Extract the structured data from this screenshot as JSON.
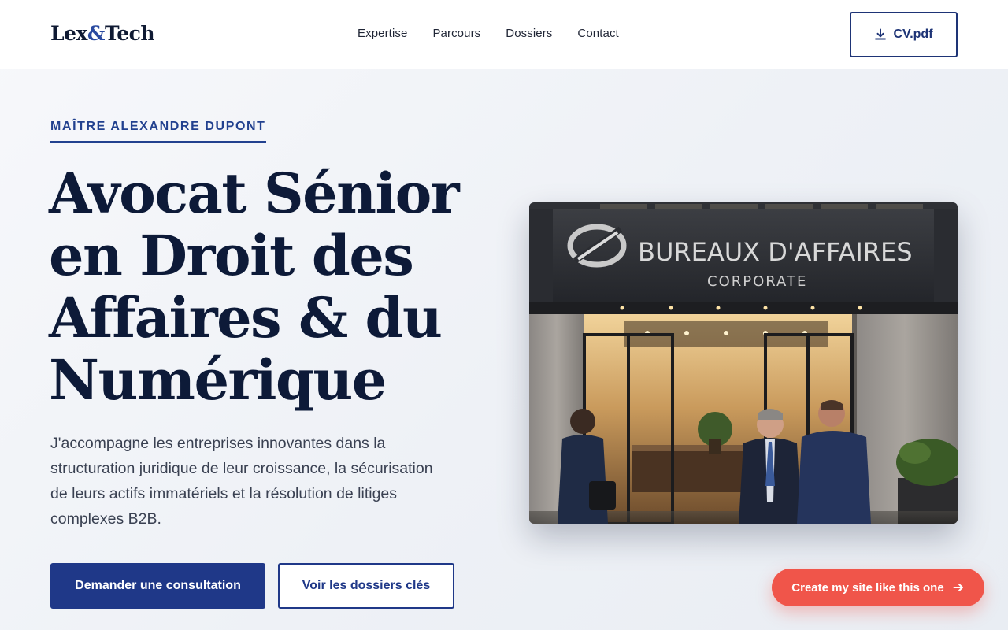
{
  "brand": {
    "logo_left": "Lex",
    "logo_amp": "&",
    "logo_right": "Tech"
  },
  "nav": {
    "items": [
      {
        "label": "Expertise"
      },
      {
        "label": "Parcours"
      },
      {
        "label": "Dossiers"
      },
      {
        "label": "Contact"
      }
    ]
  },
  "header": {
    "cv_label": "CV.pdf",
    "cv_icon": "download-icon"
  },
  "hero": {
    "eyebrow": "Maître Alexandre Dupont",
    "title": "Avocat Sénior en Droit des Affaires & du Numérique",
    "description": "J'accompagne les entreprises innovantes dans la structuration juridique de leur croissance, la sécurisation de leurs actifs immatériels et la résolution de litiges complexes B2B.",
    "primary_cta": "Demander une consultation",
    "secondary_cta": "Voir les dossiers clés"
  },
  "photo": {
    "sign_line1": "BUREAUX D'AFFAIRES",
    "sign_line2": "CORPORATE"
  },
  "floating_cta": {
    "label": "Create my site like this one",
    "icon": "arrow-right-icon"
  },
  "colors": {
    "accent": "#1f3888",
    "heading": "#0d1a38",
    "cta": "#f0554a"
  }
}
